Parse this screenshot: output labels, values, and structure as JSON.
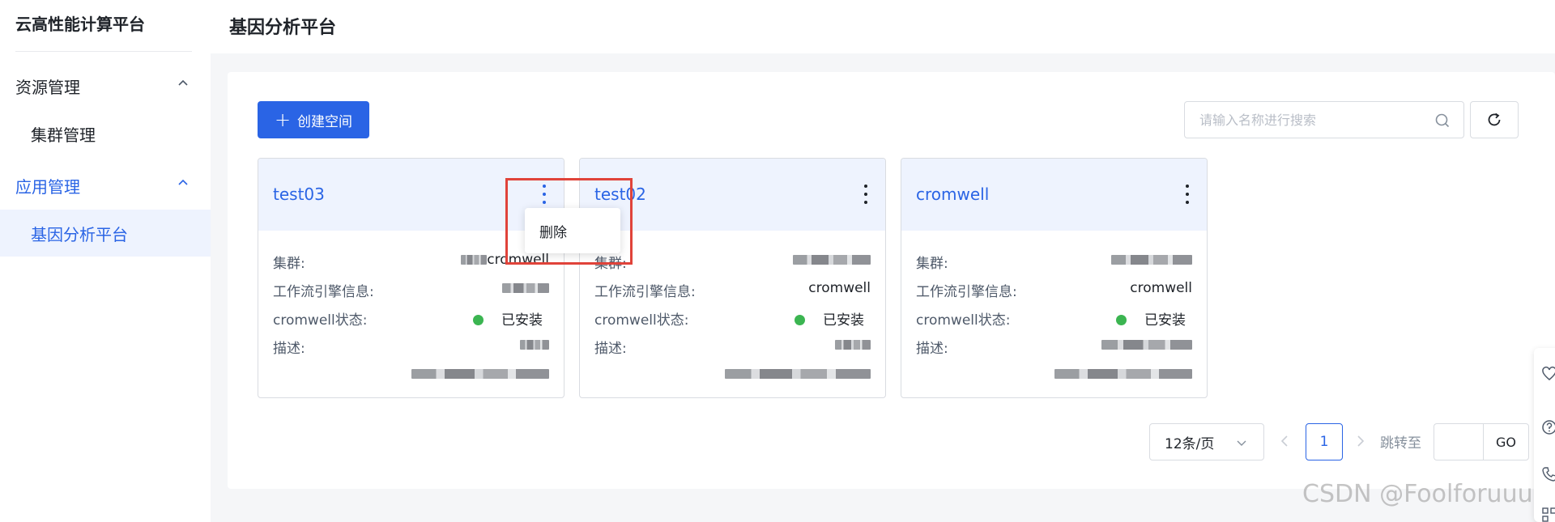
{
  "sidebar": {
    "app_title": "云高性能计算平台",
    "groups": [
      {
        "label": "资源管理",
        "items": [
          {
            "label": "集群管理"
          }
        ]
      },
      {
        "label": "应用管理",
        "items": [
          {
            "label": "基因分析平台"
          }
        ]
      }
    ]
  },
  "header": {
    "title": "基因分析平台"
  },
  "toolbar": {
    "create_label": "创建空间",
    "search_placeholder": "请输入名称进行搜索"
  },
  "card_labels": {
    "cluster": "集群:",
    "engine": "工作流引擎信息:",
    "status": "cromwell状态:",
    "desc": "描述:"
  },
  "cards": [
    {
      "name": "test03",
      "cluster": "cromwell",
      "engine": "",
      "status": "已安装",
      "desc": ""
    },
    {
      "name": "test02",
      "cluster": "",
      "engine": "cromwell",
      "status": "已安装",
      "desc": ""
    },
    {
      "name": "cromwell",
      "cluster": "",
      "engine": "cromwell",
      "status": "已安装",
      "desc": ""
    }
  ],
  "dropdown": {
    "delete_label": "删除"
  },
  "pagination": {
    "page_size": "12条/页",
    "current_page": "1",
    "jump_label": "跳转至",
    "go_label": "GO"
  },
  "watermark": "CSDN @Foolforuuu",
  "colors": {
    "primary": "#2a64e5",
    "success": "#3bb551",
    "highlight": "#e0433a"
  }
}
